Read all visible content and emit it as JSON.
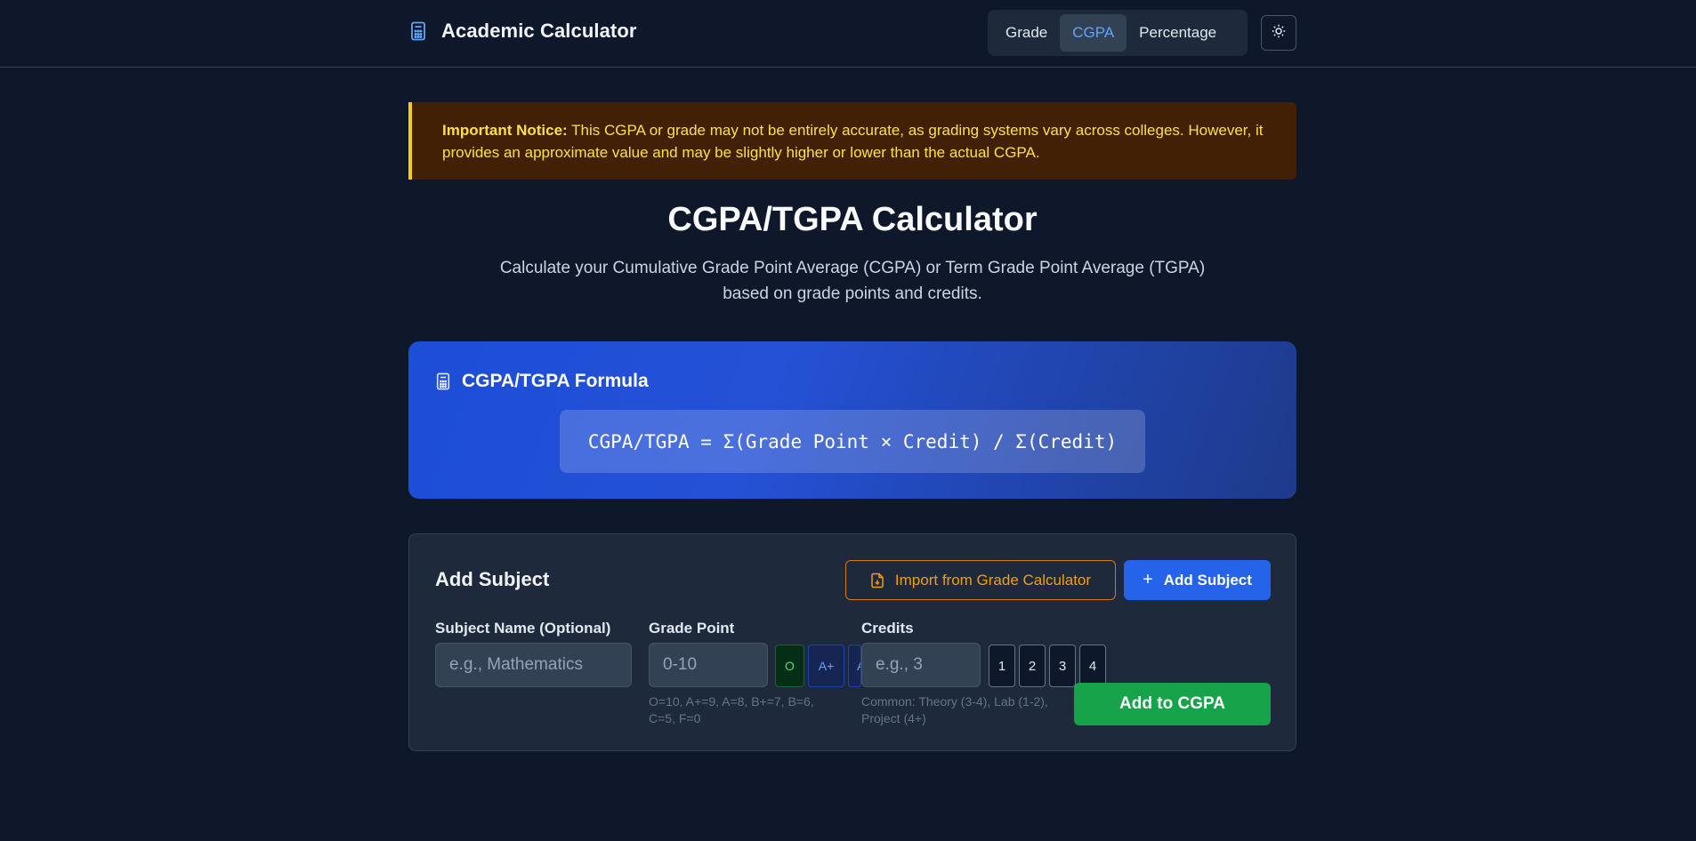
{
  "header": {
    "app_title": "Academic Calculator",
    "nav_tabs": [
      {
        "label": "Grade",
        "active": false
      },
      {
        "label": "CGPA",
        "active": true
      },
      {
        "label": "Percentage",
        "active": false
      }
    ],
    "theme_icon": "sun-icon"
  },
  "notice": {
    "bold": "Important Notice:",
    "text": " This CGPA or grade may not be entirely accurate, as grading systems vary across colleges. However, it provides an approximate value and may be slightly higher or lower than the actual CGPA."
  },
  "page": {
    "title": "CGPA/TGPA Calculator",
    "subtitle": "Calculate your Cumulative Grade Point Average (CGPA) or Term Grade Point Average (TGPA) based on grade points and credits."
  },
  "formula": {
    "title": "CGPA/TGPA Formula",
    "expression": "CGPA/TGPA = Σ(Grade Point × Credit) / Σ(Credit)",
    "icon": "calculator-icon"
  },
  "add_subject": {
    "title": "Add Subject",
    "import_label": "Import from Grade Calculator",
    "add_label": "Add Subject",
    "subject_name": {
      "label": "Subject Name (Optional)",
      "placeholder": "e.g., Mathematics",
      "value": ""
    },
    "grade_point": {
      "label": "Grade Point",
      "placeholder": "0-10",
      "value": "",
      "chips": [
        "O",
        "A+",
        "A"
      ],
      "hint": "O=10, A+=9, A=8, B+=7, B=6, C=5, F=0"
    },
    "credits": {
      "label": "Credits",
      "placeholder": "e.g., 3",
      "value": "",
      "chips": [
        "1",
        "2",
        "3",
        "4"
      ],
      "hint": "Common: Theory (3-4), Lab (1-2), Project (4+)"
    },
    "submit_label": "Add to CGPA"
  },
  "colors": {
    "background": "#0f172a",
    "accent": "#2563eb",
    "success": "#16a34a",
    "warning": "#facc15"
  }
}
